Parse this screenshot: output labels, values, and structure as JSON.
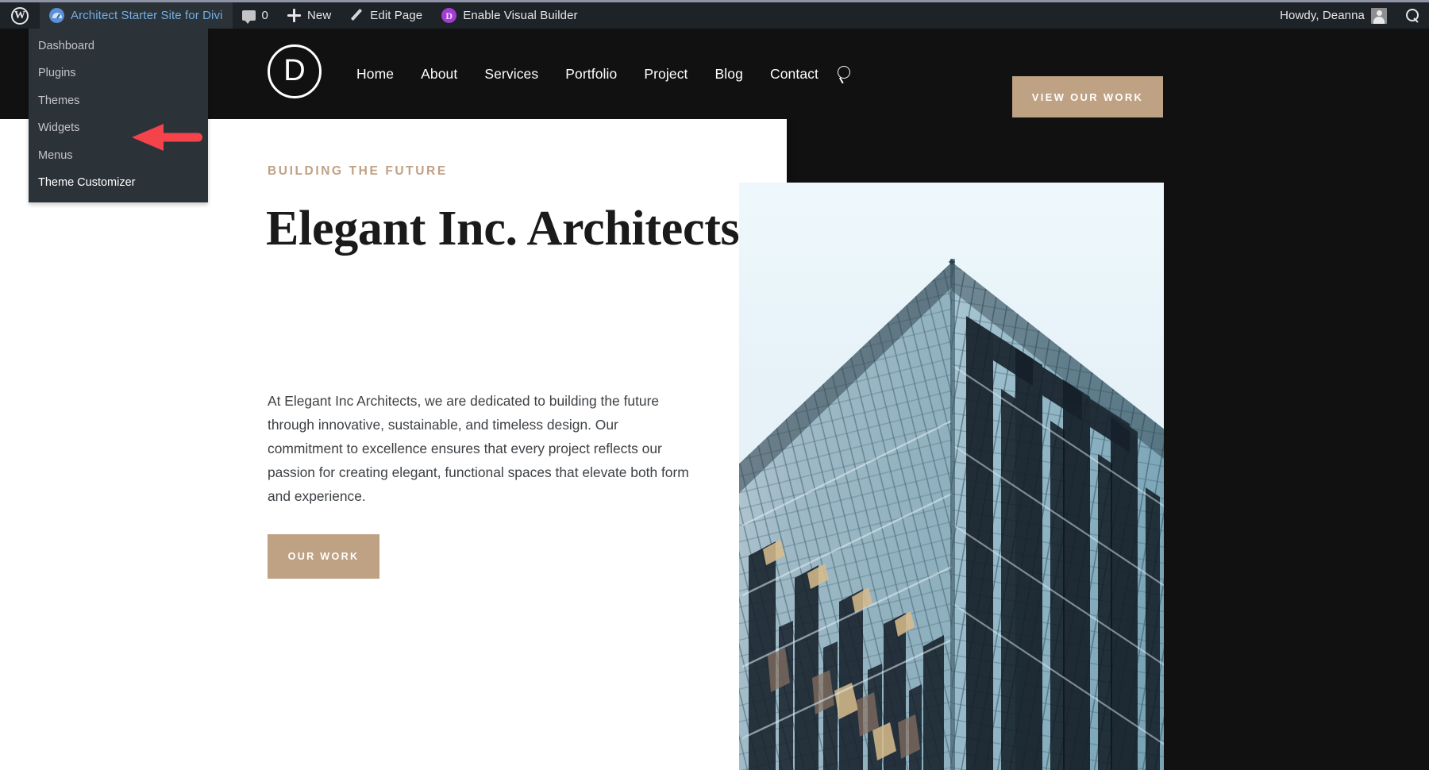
{
  "adminbar": {
    "wp_logo_icon": "wordpress-logo-icon",
    "site_name": "Architect Starter Site for Divi",
    "site_icon": "dashboard-speedometer-icon",
    "comments_icon": "comment-bubble-icon",
    "comments_count": "0",
    "new_icon": "plus-icon",
    "new_label": "New",
    "edit_icon": "pencil-icon",
    "edit_label": "Edit Page",
    "divi_icon": "divi-d-icon",
    "divi_label": "Enable Visual Builder",
    "howdy": "Howdy, Deanna",
    "avatar_icon": "user-avatar-icon",
    "search_icon": "search-icon",
    "bg_color": "#1d2327",
    "link_color": "#72aee6"
  },
  "dropdown": {
    "items": [
      {
        "label": "Dashboard",
        "highlighted": false
      },
      {
        "label": "Plugins",
        "highlighted": false
      },
      {
        "label": "Themes",
        "highlighted": false
      },
      {
        "label": "Widgets",
        "highlighted": false
      },
      {
        "label": "Menus",
        "highlighted": false
      },
      {
        "label": "Theme Customizer",
        "highlighted": true
      }
    ],
    "bg_color": "#2c3338"
  },
  "annotation": {
    "arrow_icon": "red-arrow-left-icon",
    "arrow_color": "#F4434B",
    "points_at": "Theme Customizer"
  },
  "site_header": {
    "logo_icon": "divi-circle-d-logo-icon",
    "logo_letter": "D",
    "nav": [
      {
        "label": "Home"
      },
      {
        "label": "About"
      },
      {
        "label": "Services"
      },
      {
        "label": "Portfolio"
      },
      {
        "label": "Project"
      },
      {
        "label": "Blog"
      },
      {
        "label": "Contact"
      }
    ],
    "search_icon": "search-icon",
    "cta_label": "VIEW OUR WORK",
    "bg_color": "#111111",
    "accent_color": "#bfa184"
  },
  "hero": {
    "eyebrow": "BUILDING THE FUTURE",
    "headline": "Elegant Inc. Architects",
    "body": "At Elegant Inc Architects, we are dedicated to building the future through innovative, sustainable, and timeless design. Our commitment to excellence ensures that every project reflects our passion for creating elegant, functional spaces that elevate both form and experience.",
    "cta_label": "OUR WORK",
    "image_alt": "glass-skyscraper-photo",
    "panel_bg": "#ffffff",
    "text_color": "#3d4145"
  }
}
